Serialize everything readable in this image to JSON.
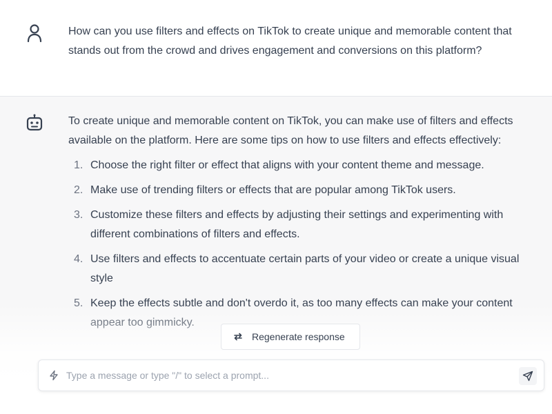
{
  "conversation": {
    "user_message": "How can you use filters and effects on TikTok to create unique and memorable content that stands out from the crowd and drives engagement and conversions on this platform?",
    "assistant_intro": "To create unique and memorable content on TikTok, you can make use of filters and effects available on the platform. Here are some tips on how to use filters and effects effectively:",
    "tips": [
      {
        "num": "1.",
        "text": "Choose the right filter or effect that aligns with your content theme and message."
      },
      {
        "num": "2.",
        "text": "Make use of trending filters or effects that are popular among TikTok users."
      },
      {
        "num": "3.",
        "text": "Customize these filters and effects by adjusting their settings and experimenting with different combinations of filters and effects."
      },
      {
        "num": "4.",
        "text": "Use filters and effects to accentuate certain parts of your video or create a unique visual style"
      },
      {
        "num": "5.",
        "text": "Keep the effects subtle and don't overdo it, as too many effects can make your content appear too gimmicky."
      }
    ]
  },
  "controls": {
    "regenerate_label": "Regenerate response",
    "input_placeholder": "Type a message or type \"/\" to select a prompt...",
    "input_value": ""
  },
  "icons": {
    "user": "user-icon",
    "bot": "bot-icon",
    "regenerate": "refresh-icon",
    "bolt": "lightning-bolt-icon",
    "send": "paper-plane-icon"
  },
  "colors": {
    "text": "#374151",
    "assistant_background": "#f7f7f8",
    "border": "#e5e7eb",
    "placeholder": "#9ca3af"
  }
}
